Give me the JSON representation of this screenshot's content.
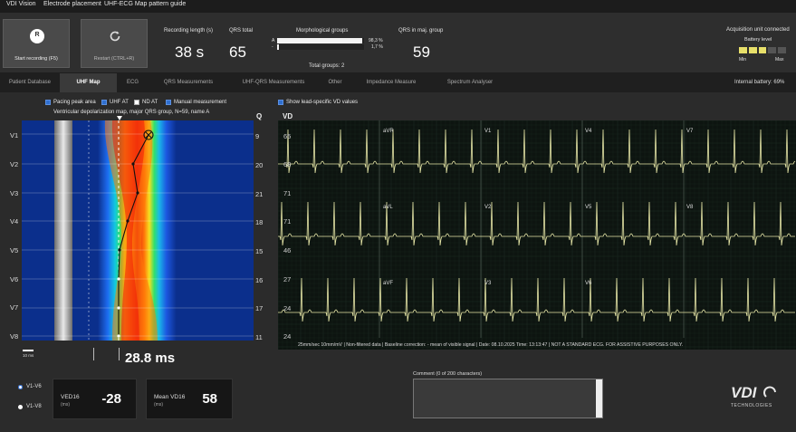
{
  "menu": [
    "VDI Vision",
    "Electrode placement",
    "UHF-ECG Map pattern guide"
  ],
  "buttons": {
    "start": {
      "icon": "R",
      "label": "Start recording (F5)"
    },
    "restart": {
      "label": "Restart (CTRL+R)"
    }
  },
  "stats": {
    "recording_length_label": "Recording length (s)",
    "recording_length": "38 s",
    "qrs_total_label": "QRS total",
    "qrs_total": "65",
    "morph_label": "Morphological groups",
    "morph_rows": [
      {
        "name": "A",
        "pct": "98,3 %",
        "fill": 0.983
      },
      {
        "name": "-",
        "pct": "1,7 %",
        "fill": 0.017
      }
    ],
    "total_groups": "Total groups: 2",
    "qrs_maj_label": "QRS in maj. group",
    "qrs_maj": "59"
  },
  "acquisition": {
    "title": "Acquisition unit connected",
    "battery_label": "Battery level",
    "min": "Min",
    "max": "Max",
    "battery_cells": 5,
    "battery_filled": 3,
    "internal_battery": "Internal battery: 69%"
  },
  "tabs": [
    "Patient Database",
    "UHF Map",
    "ECG",
    "QRS Measurements",
    "UHF-QRS Measurements",
    "Other",
    "Impedance Measure",
    "Spectrum Analyser"
  ],
  "active_tab": 1,
  "options": {
    "pacing": "Pacing peak area",
    "uhf_at": "UHF AT",
    "nd_at": "ND AT",
    "manual": "Manual measurement",
    "lead_specific": "Show lead-specific VD values"
  },
  "map": {
    "title": "Ventricular depolarization map, major QRS group, N=59, name A",
    "q_header": "Q",
    "leads": [
      "V1",
      "V2",
      "V3",
      "V4",
      "V5",
      "V6",
      "V7",
      "V8"
    ],
    "q_values": [
      "9",
      "20",
      "21",
      "18",
      "15",
      "16",
      "17",
      "11"
    ],
    "scale_label": "10 ms",
    "vd_ms": "28.8 ms"
  },
  "ecg": {
    "vd_header": "VD",
    "vd_values": [
      "65",
      "68",
      "71",
      "71",
      "46",
      "27",
      "24",
      "24"
    ],
    "lead_labels": [
      "aVR",
      "V1",
      "V4",
      "V7",
      "aVL",
      "V2",
      "V5",
      "V8",
      "aVF",
      "V3",
      "V6"
    ],
    "footer": "25mm/sec   10mm/mV  |  Non-filtered data  |  Baseline correction: - mean of visible signal  |  Date: 08.10.2025 Time: 13:13:47  |  NOT A STANDARD ECG. FOR ASSISTIVE PURPOSES ONLY."
  },
  "bottom": {
    "radio1": "V1-V6",
    "radio2": "V1-V8",
    "ved16_label": "VED16",
    "ved16_unit": "(ms)",
    "ved16_value": "-28",
    "meanvd_label": "Mean VD16",
    "meanvd_unit": "(ms)",
    "meanvd_value": "58",
    "comment_label": "Comment (0 of 200 characters)",
    "logo": "VDI",
    "logo_sub": "TECHNOLOGIES"
  }
}
